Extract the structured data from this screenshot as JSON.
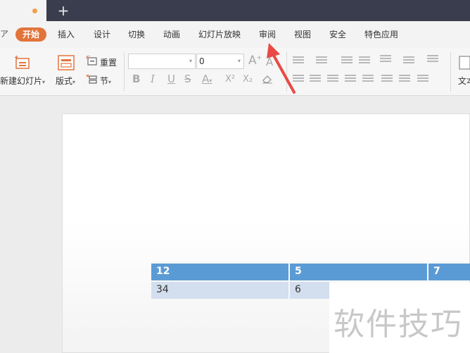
{
  "tabs": {
    "new_tab_glyph": "+"
  },
  "menu": {
    "partial_left": "ア",
    "active": "开始",
    "items": [
      "插入",
      "设计",
      "切换",
      "动画",
      "幻灯片放映",
      "审阅",
      "视图",
      "安全",
      "特色应用"
    ]
  },
  "ribbon": {
    "new_slide": "新建幻灯片",
    "layout": "版式",
    "reset": "重置",
    "section": "节",
    "font_size": "0",
    "text_partial": "文本",
    "dropdown_mark": "▾",
    "grow_font": "A",
    "shrink_font": "A",
    "bold": "B",
    "italic": "I",
    "underline": "U",
    "strike": "S",
    "font_color": "A",
    "superscript": "X²",
    "subscript": "X₂"
  },
  "table": {
    "header": [
      "12",
      "5",
      "7"
    ],
    "row1": [
      "34",
      "6"
    ]
  },
  "watermark": "软件技巧",
  "colors": {
    "accent": "#e2743a",
    "header_fill": "#5b9bd5",
    "body_fill": "#d3deef",
    "arrow": "#e84a45"
  }
}
